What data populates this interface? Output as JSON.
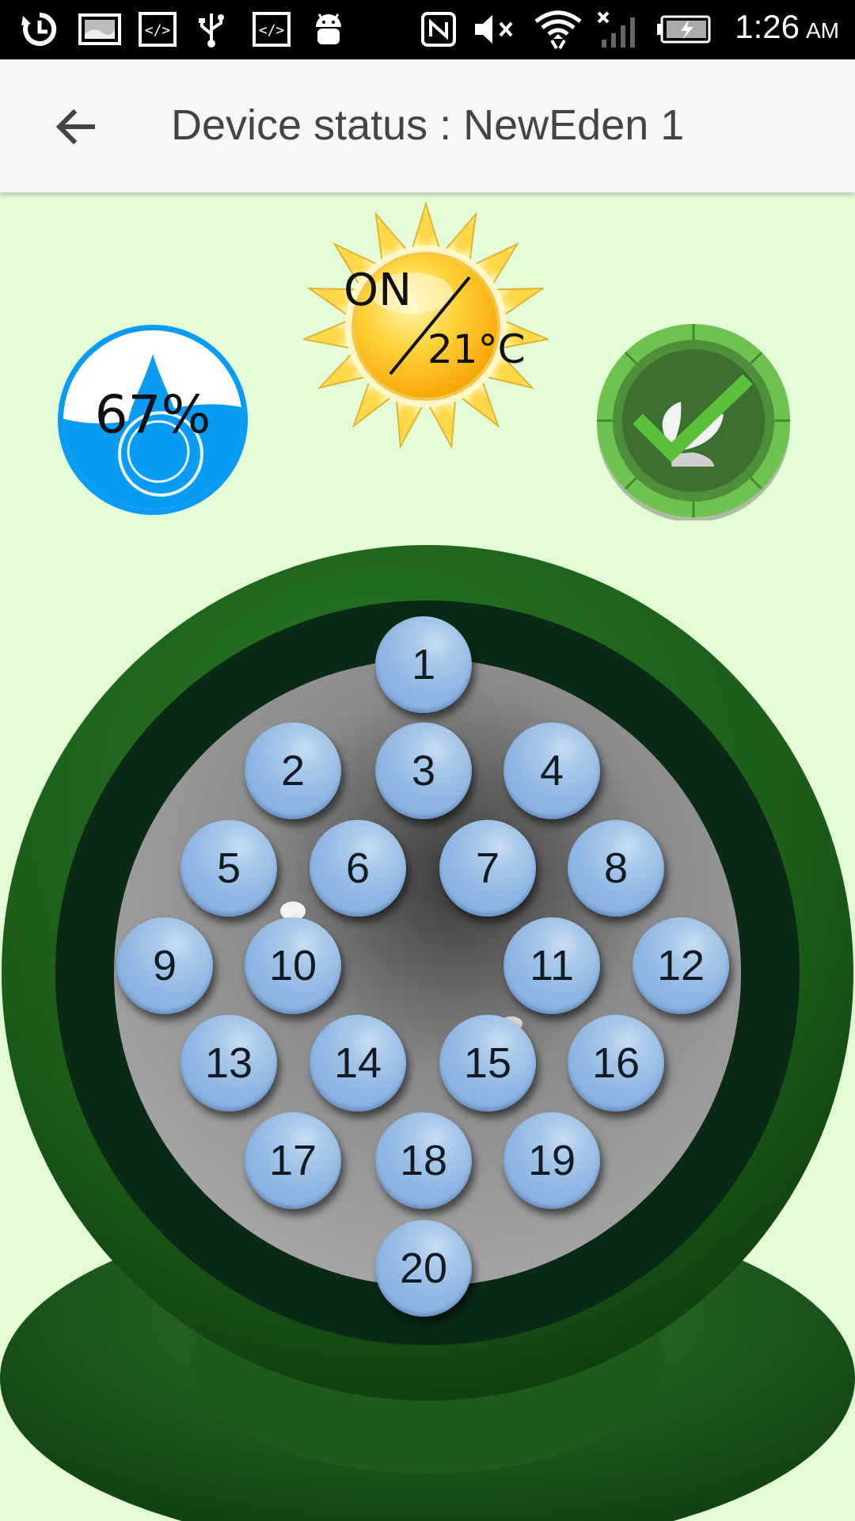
{
  "status_bar": {
    "time": "1:26",
    "ampm": "AM",
    "icons": [
      "sync-icon",
      "gallery-icon",
      "code-icon",
      "usb-icon",
      "code-icon",
      "android-icon",
      "nfc-icon",
      "mute-icon",
      "wifi-icon",
      "no-signal-icon",
      "battery-charging-icon"
    ]
  },
  "app_bar": {
    "title": "Device status : NewEden 1",
    "back_icon": "arrow-left-icon"
  },
  "status": {
    "moisture": "67%",
    "light_state": "ON",
    "temperature": "21°C",
    "plant_icon": "plant-ok-icon"
  },
  "plugs": {
    "p1": "1",
    "p2": "2",
    "p3": "3",
    "p4": "4",
    "p5": "5",
    "p6": "6",
    "p7": "7",
    "p8": "8",
    "p9": "9",
    "p10": "10",
    "p11": "11",
    "p12": "12",
    "p13": "13",
    "p14": "14",
    "p15": "15",
    "p16": "16",
    "p17": "17",
    "p18": "18",
    "p19": "19",
    "p20": "20"
  },
  "colors": {
    "background": "#e3fbd7",
    "device_green": "#1c5c1a",
    "device_dark": "#0b2a16",
    "plug_blue": "#8fb7e3",
    "water_blue": "#0a9bf5",
    "sun_yellow": "#ffd23a",
    "plant_green": "#4f8e3a"
  }
}
